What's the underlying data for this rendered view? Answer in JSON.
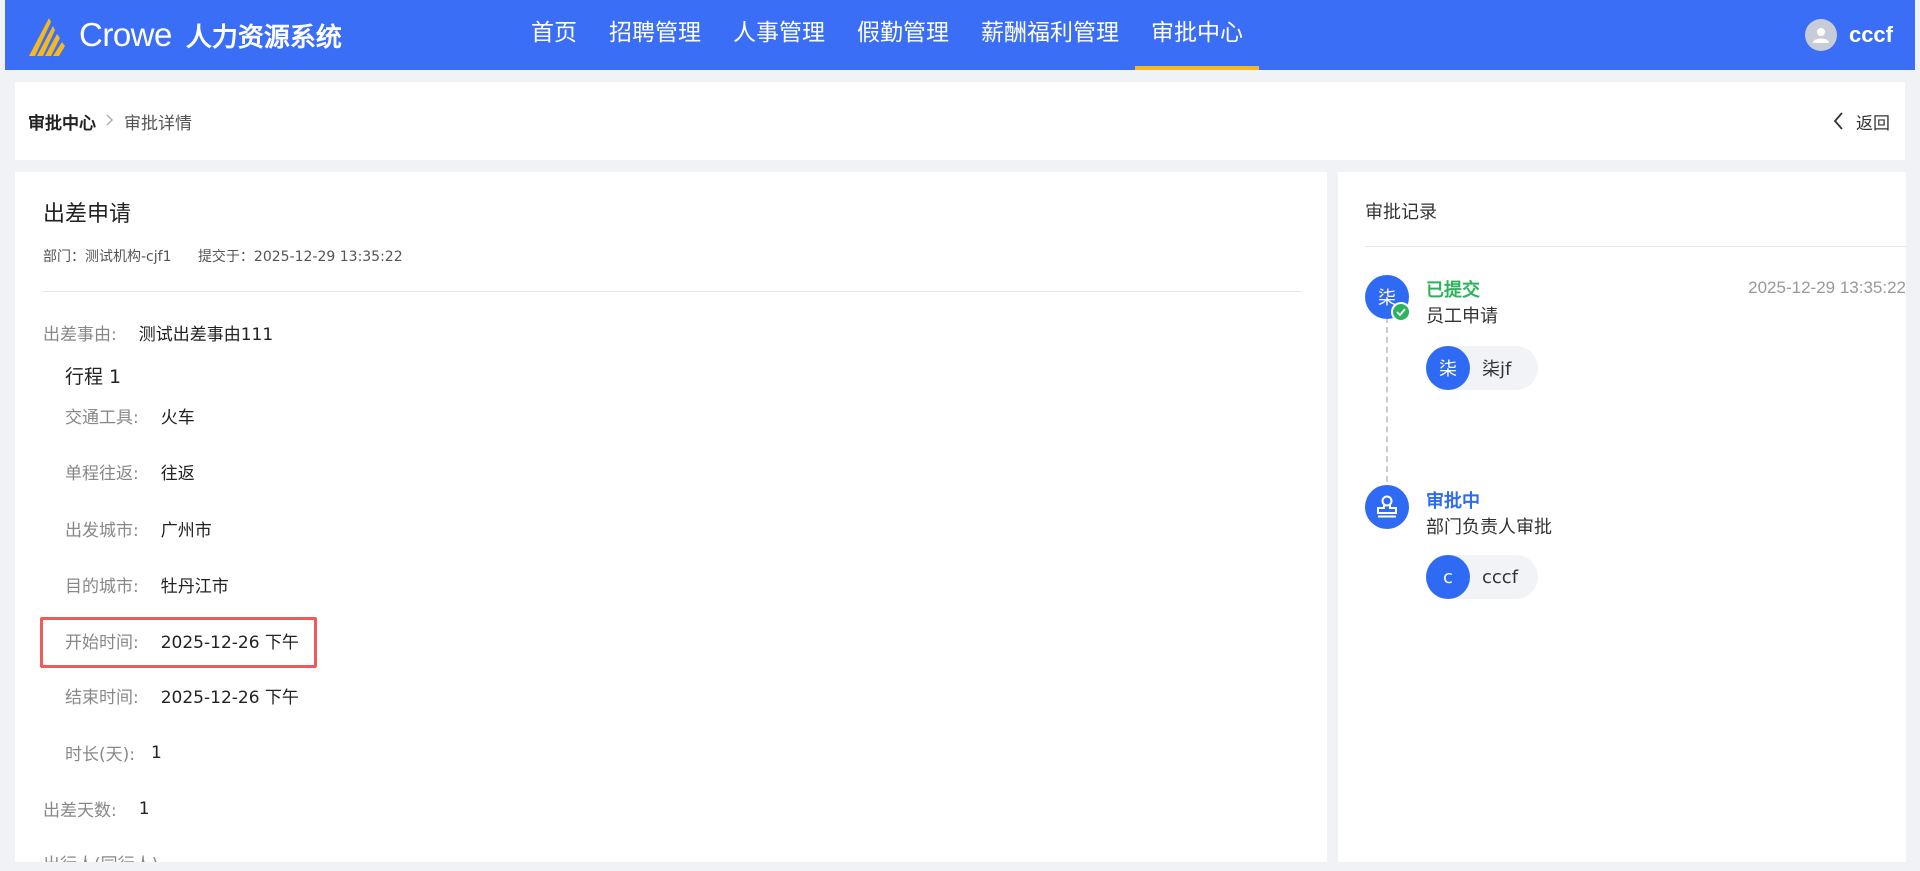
{
  "header": {
    "brand": "Crowe",
    "system_name": "人力资源系统",
    "nav": [
      {
        "label": "首页",
        "active": false
      },
      {
        "label": "招聘管理",
        "active": false
      },
      {
        "label": "人事管理",
        "active": false
      },
      {
        "label": "假勤管理",
        "active": false
      },
      {
        "label": "薪酬福利管理",
        "active": false
      },
      {
        "label": "审批中心",
        "active": true
      }
    ],
    "user": {
      "name": "cccf",
      "icon": "user-avatar-icon"
    },
    "colors": {
      "primary": "#3b6ef6",
      "active_underline": "#f5b821"
    }
  },
  "breadcrumb": {
    "root": "审批中心",
    "current": "审批详情",
    "back_label": "返回"
  },
  "form": {
    "title": "出差申请",
    "department": "部门：测试机构-cjf1",
    "submitted": "提交于：2025-12-29 13:35:22",
    "reason_label": "出差事由:",
    "reason_value": "测试出差事由111",
    "trip_title": "行程 1",
    "trip_fields": [
      {
        "label": "交通工具:",
        "value": "火车"
      },
      {
        "label": "单程往返:",
        "value": "往返"
      },
      {
        "label": "出发城市:",
        "value": "广州市"
      },
      {
        "label": "目的城市:",
        "value": "牡丹江市"
      },
      {
        "label": "开始时间:",
        "value": "2025-12-26 下午"
      },
      {
        "label": "结束时间:",
        "value": "2025-12-26 下午"
      },
      {
        "label": "时长(天):",
        "value": "1"
      }
    ],
    "days_label": "出差天数:",
    "days_value": "1",
    "companions_label": "出行人(同行人)"
  },
  "approval": {
    "title": "审批记录",
    "steps": [
      {
        "node_text": "柒",
        "status": "已提交",
        "status_color": "#2db35e",
        "desc": "员工申请",
        "time": "2025-12-29 13:35:22",
        "person_avatar": "柒",
        "person_name": "柒jf"
      },
      {
        "node_icon": "stamp-icon",
        "status": "审批中",
        "status_color": "#2f6af5",
        "desc": "部门负责人审批",
        "person_avatar": "c",
        "person_name": "cccf"
      }
    ]
  }
}
